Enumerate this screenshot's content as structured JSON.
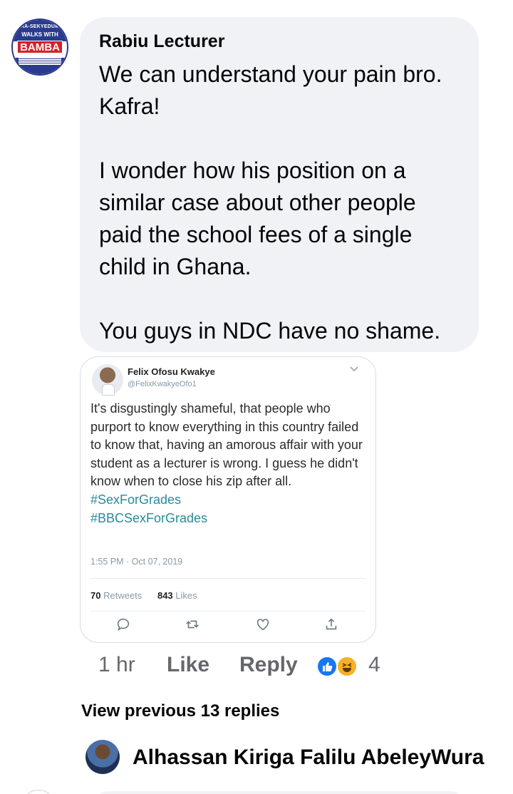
{
  "comment": {
    "author": "Rabiu Lecturer",
    "avatar_icon": "bamba-campaign-logo",
    "avatar_text": {
      "line1": "URA-SEKYEDUMA",
      "line2": "WALKS WITH",
      "badge": "BAMBA"
    },
    "lines": [
      "We can understand your pain bro.",
      "Kafra!",
      "",
      "I wonder how his position on a",
      "similar case about other people",
      "paid the school fees of a single",
      "child in Ghana.",
      "",
      "You guys in NDC have no shame."
    ]
  },
  "tweet": {
    "name": "Felix Ofosu Kwakye",
    "handle": "@FelixKwakyeOfo1",
    "text": "It's disgustingly shameful, that people who purport to know everything in this country failed to know that, having an amorous affair with your student as a lecturer is wrong. I guess he didn't know when to close his zip after all.",
    "hashtags": [
      "#SexForGrades",
      "#BBCSexForGrades"
    ],
    "timestamp": "1:55 PM · Oct 07, 2019",
    "retweets_count": "70",
    "retweets_label": "Retweets",
    "likes_count": "843",
    "likes_label": "Likes",
    "actions": [
      "reply-icon",
      "retweet-icon",
      "heart-icon",
      "share-icon"
    ]
  },
  "meta": {
    "time": "1 hr",
    "like_label": "Like",
    "reply_label": "Reply",
    "reactions": [
      "like-reaction-icon",
      "haha-reaction-icon"
    ],
    "reaction_count": "4",
    "colors": {
      "like": "#1877f2",
      "haha": "#f7b125",
      "meta_text": "#65676b"
    }
  },
  "replies": {
    "view_previous": "View previous 13 replies",
    "reply_author": "Alhassan Kiriga Falilu AbeleyWura"
  }
}
